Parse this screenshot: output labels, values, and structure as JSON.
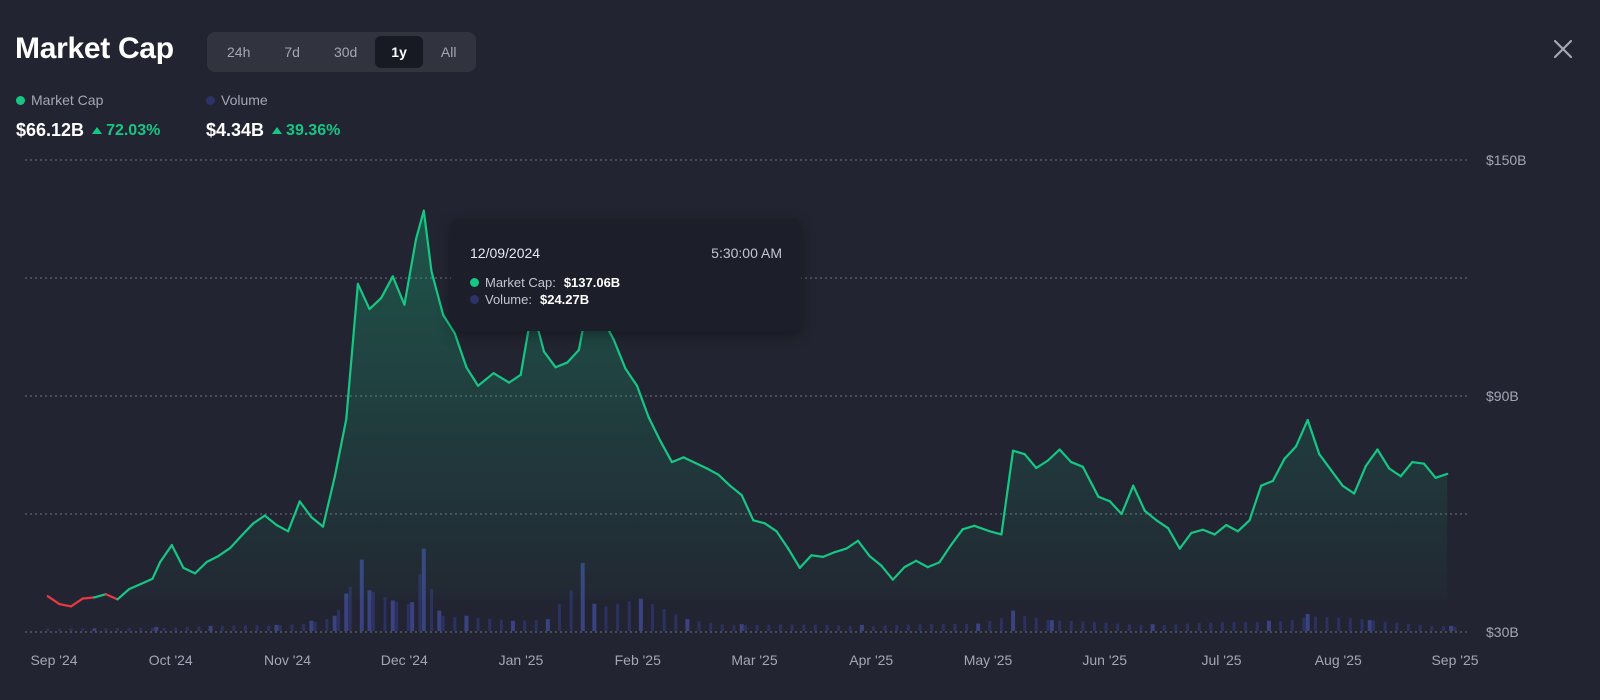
{
  "header": {
    "title": "Market Cap",
    "tabs": [
      {
        "label": "24h",
        "active": false
      },
      {
        "label": "7d",
        "active": false
      },
      {
        "label": "30d",
        "active": false
      },
      {
        "label": "1y",
        "active": true
      },
      {
        "label": "All",
        "active": false
      }
    ],
    "close_icon": "close-icon"
  },
  "legend": {
    "market_cap": {
      "label": "Market Cap",
      "value": "$66.12B",
      "change": "72.03%",
      "color": "#16c784"
    },
    "volume": {
      "label": "Volume",
      "value": "$4.34B",
      "change": "39.36%",
      "color": "#2c3366"
    }
  },
  "tooltip": {
    "date": "12/09/2024",
    "time": "5:30:00 AM",
    "market_cap_label": "Market Cap:",
    "market_cap_value": "$137.06B",
    "volume_label": "Volume:",
    "volume_value": "$24.27B"
  },
  "colors": {
    "up": "#16c784",
    "down": "#ea3943",
    "volume": "#2c3366",
    "grid": "#8a8d99",
    "background": "#222431"
  },
  "chart_data": {
    "type": "line",
    "ylim": [
      30,
      150
    ],
    "y_ticks": [
      {
        "value": 30,
        "label": "$30B"
      },
      {
        "value": 90,
        "label": "$90B"
      },
      {
        "value": 150,
        "label": "$150B"
      }
    ],
    "grid_lines": [
      30,
      60,
      90,
      120,
      150
    ],
    "x_tick_labels": [
      "Sep '24",
      "Oct '24",
      "Nov '24",
      "Dec '24",
      "Jan '25",
      "Feb '25",
      "Mar '25",
      "Apr '25",
      "May '25",
      "Jun '25",
      "Jul '25",
      "Aug '25",
      "Sep '25"
    ],
    "x_range": [
      "2024-09-01",
      "2025-09-01"
    ],
    "series": [
      {
        "name": "Market Cap",
        "unit": "B USD",
        "points": [
          [
            "2024-09-03",
            39.1
          ],
          [
            "2024-09-06",
            37.1
          ],
          [
            "2024-09-09",
            36.5
          ],
          [
            "2024-09-12",
            38.5
          ],
          [
            "2024-09-15",
            38.8
          ],
          [
            "2024-09-18",
            39.6
          ],
          [
            "2024-09-21",
            38.3
          ],
          [
            "2024-09-24",
            40.9
          ],
          [
            "2024-09-27",
            42.2
          ],
          [
            "2024-09-30",
            43.5
          ],
          [
            "2024-10-02",
            47.8
          ],
          [
            "2024-10-05",
            52.1
          ],
          [
            "2024-10-08",
            46.3
          ],
          [
            "2024-10-11",
            44.9
          ],
          [
            "2024-10-14",
            47.8
          ],
          [
            "2024-10-17",
            49.3
          ],
          [
            "2024-10-20",
            51.3
          ],
          [
            "2024-10-23",
            54.5
          ],
          [
            "2024-10-26",
            57.6
          ],
          [
            "2024-10-29",
            59.6
          ],
          [
            "2024-11-01",
            57.2
          ],
          [
            "2024-11-04",
            55.6
          ],
          [
            "2024-11-07",
            63.2
          ],
          [
            "2024-11-10",
            59.2
          ],
          [
            "2024-11-13",
            56.8
          ],
          [
            "2024-11-16",
            69.3
          ],
          [
            "2024-11-19",
            84.1
          ],
          [
            "2024-11-22",
            118.5
          ],
          [
            "2024-11-25",
            112.1
          ],
          [
            "2024-11-28",
            114.9
          ],
          [
            "2024-12-01",
            120.4
          ],
          [
            "2024-12-04",
            113.2
          ],
          [
            "2024-12-07",
            129.9
          ],
          [
            "2024-12-09",
            137.1
          ],
          [
            "2024-12-11",
            121.6
          ],
          [
            "2024-12-14",
            110.6
          ],
          [
            "2024-12-17",
            105.9
          ],
          [
            "2024-12-20",
            97.3
          ],
          [
            "2024-12-23",
            92.6
          ],
          [
            "2024-12-27",
            95.8
          ],
          [
            "2024-12-31",
            93.4
          ],
          [
            "2025-01-03",
            95.4
          ],
          [
            "2025-01-06",
            112.5
          ],
          [
            "2025-01-09",
            101.3
          ],
          [
            "2025-01-12",
            97.3
          ],
          [
            "2025-01-15",
            98.5
          ],
          [
            "2025-01-18",
            101.7
          ],
          [
            "2025-01-21",
            117.3
          ],
          [
            "2025-01-24",
            109.9
          ],
          [
            "2025-01-27",
            104.3
          ],
          [
            "2025-01-30",
            97.0
          ],
          [
            "2025-02-02",
            92.6
          ],
          [
            "2025-02-05",
            84.6
          ],
          [
            "2025-02-08",
            78.6
          ],
          [
            "2025-02-11",
            73.2
          ],
          [
            "2025-02-14",
            74.4
          ],
          [
            "2025-02-17",
            73.0
          ],
          [
            "2025-02-20",
            71.6
          ],
          [
            "2025-02-23",
            70.0
          ],
          [
            "2025-02-26",
            67.2
          ],
          [
            "2025-03-01",
            64.8
          ],
          [
            "2025-03-04",
            58.4
          ],
          [
            "2025-03-07",
            57.6
          ],
          [
            "2025-03-10",
            55.6
          ],
          [
            "2025-03-13",
            51.2
          ],
          [
            "2025-03-16",
            46.3
          ],
          [
            "2025-03-19",
            49.5
          ],
          [
            "2025-03-22",
            49.1
          ],
          [
            "2025-03-25",
            50.3
          ],
          [
            "2025-03-28",
            51.2
          ],
          [
            "2025-03-31",
            53.2
          ],
          [
            "2025-04-03",
            49.3
          ],
          [
            "2025-04-06",
            46.9
          ],
          [
            "2025-04-09",
            43.3
          ],
          [
            "2025-04-12",
            46.5
          ],
          [
            "2025-04-15",
            48.1
          ],
          [
            "2025-04-18",
            46.5
          ],
          [
            "2025-04-21",
            47.7
          ],
          [
            "2025-04-24",
            52.1
          ],
          [
            "2025-04-27",
            56.1
          ],
          [
            "2025-04-30",
            57.0
          ],
          [
            "2025-05-04",
            55.6
          ],
          [
            "2025-05-07",
            54.8
          ],
          [
            "2025-05-10",
            76.1
          ],
          [
            "2025-05-13",
            75.2
          ],
          [
            "2025-05-16",
            71.7
          ],
          [
            "2025-05-19",
            73.6
          ],
          [
            "2025-05-22",
            76.4
          ],
          [
            "2025-05-25",
            73.2
          ],
          [
            "2025-05-28",
            72.0
          ],
          [
            "2025-06-01",
            64.4
          ],
          [
            "2025-06-04",
            63.2
          ],
          [
            "2025-06-07",
            60.0
          ],
          [
            "2025-06-10",
            67.2
          ],
          [
            "2025-06-13",
            60.8
          ],
          [
            "2025-06-16",
            58.4
          ],
          [
            "2025-06-19",
            56.4
          ],
          [
            "2025-06-22",
            51.2
          ],
          [
            "2025-06-25",
            55.2
          ],
          [
            "2025-06-28",
            56.0
          ],
          [
            "2025-07-01",
            54.8
          ],
          [
            "2025-07-04",
            57.2
          ],
          [
            "2025-07-07",
            55.6
          ],
          [
            "2025-07-10",
            58.4
          ],
          [
            "2025-07-13",
            67.2
          ],
          [
            "2025-07-16",
            68.4
          ],
          [
            "2025-07-19",
            74.0
          ],
          [
            "2025-07-22",
            77.2
          ],
          [
            "2025-07-25",
            83.9
          ],
          [
            "2025-07-28",
            75.2
          ],
          [
            "2025-07-31",
            71.2
          ],
          [
            "2025-08-03",
            67.2
          ],
          [
            "2025-08-06",
            65.2
          ],
          [
            "2025-08-09",
            72.2
          ],
          [
            "2025-08-12",
            76.4
          ],
          [
            "2025-08-15",
            71.6
          ],
          [
            "2025-08-18",
            69.6
          ],
          [
            "2025-08-21",
            73.2
          ],
          [
            "2025-08-24",
            72.8
          ],
          [
            "2025-08-27",
            69.2
          ],
          [
            "2025-08-30",
            70.2
          ]
        ]
      },
      {
        "name": "Volume",
        "unit": "B USD",
        "points": [
          [
            "2024-09-15",
            0.8
          ],
          [
            "2024-10-01",
            1.2
          ],
          [
            "2024-10-15",
            1.5
          ],
          [
            "2024-11-01",
            1.8
          ],
          [
            "2024-11-10",
            3.0
          ],
          [
            "2024-11-16",
            4.5
          ],
          [
            "2024-11-19",
            11.0
          ],
          [
            "2024-11-23",
            21.0
          ],
          [
            "2024-11-25",
            12.0
          ],
          [
            "2024-12-01",
            9.0
          ],
          [
            "2024-12-06",
            8.5
          ],
          [
            "2024-12-09",
            24.27
          ],
          [
            "2024-12-13",
            6.0
          ],
          [
            "2024-12-20",
            4.5
          ],
          [
            "2025-01-01",
            3.0
          ],
          [
            "2025-01-10",
            3.5
          ],
          [
            "2025-01-19",
            20.0
          ],
          [
            "2025-01-22",
            8.0
          ],
          [
            "2025-02-03",
            9.5
          ],
          [
            "2025-02-15",
            3.5
          ],
          [
            "2025-03-01",
            2.0
          ],
          [
            "2025-04-01",
            1.8
          ],
          [
            "2025-05-01",
            2.2
          ],
          [
            "2025-05-10",
            6.0
          ],
          [
            "2025-05-20",
            3.2
          ],
          [
            "2025-06-15",
            2.0
          ],
          [
            "2025-07-15",
            3.0
          ],
          [
            "2025-07-25",
            5.0
          ],
          [
            "2025-08-10",
            3.2
          ],
          [
            "2025-08-31",
            1.5
          ]
        ]
      }
    ]
  }
}
